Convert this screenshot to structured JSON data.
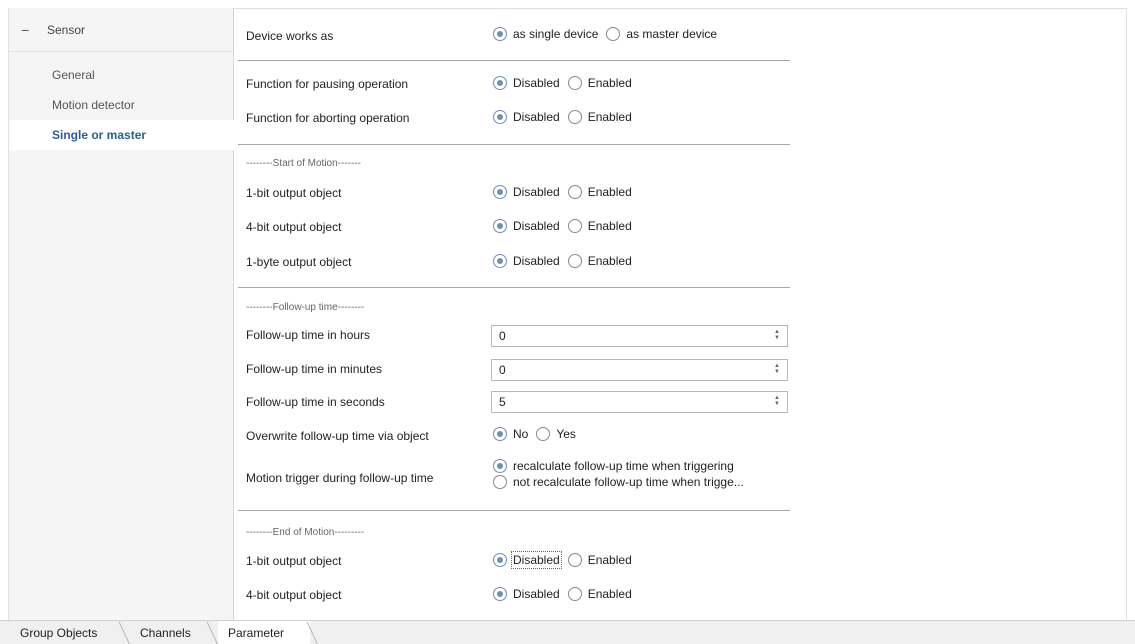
{
  "sidebar": {
    "root_label": "Sensor",
    "items": [
      {
        "label": "General"
      },
      {
        "label": "Motion detector"
      },
      {
        "label": "Single or master"
      }
    ]
  },
  "params": {
    "device_works_as": {
      "label": "Device works as",
      "opt1": "as single device",
      "opt2": "as master device"
    },
    "pausing": {
      "label": "Function for pausing operation",
      "opt1": "Disabled",
      "opt2": "Enabled"
    },
    "aborting": {
      "label": "Function for aborting operation",
      "opt1": "Disabled",
      "opt2": "Enabled"
    },
    "start_header": "--------Start of Motion-------",
    "start_1bit": {
      "label": "1-bit output object",
      "opt1": "Disabled",
      "opt2": "Enabled"
    },
    "start_4bit": {
      "label": "4-bit output object",
      "opt1": "Disabled",
      "opt2": "Enabled"
    },
    "start_1byte": {
      "label": "1-byte output object",
      "opt1": "Disabled",
      "opt2": "Enabled"
    },
    "follow_header": "--------Follow-up time--------",
    "hours": {
      "label": "Follow-up time in hours",
      "value": "0"
    },
    "minutes": {
      "label": "Follow-up time in minutes",
      "value": "0"
    },
    "seconds": {
      "label": "Follow-up time in seconds",
      "value": "5"
    },
    "overwrite": {
      "label": "Overwrite follow-up time via object",
      "opt1": "No",
      "opt2": "Yes"
    },
    "trigger": {
      "label": "Motion trigger during follow-up time",
      "opt1": "recalculate follow-up time when triggering",
      "opt2": "not recalculate follow-up time when trigge..."
    },
    "end_header": "--------End of Motion---------",
    "end_1bit": {
      "label": "1-bit output object",
      "opt1": "Disabled",
      "opt2": "Enabled"
    },
    "end_4bit": {
      "label": "4-bit output object",
      "opt1": "Disabled",
      "opt2": "Enabled"
    }
  },
  "tabs": [
    {
      "label": "Group Objects"
    },
    {
      "label": "Channels"
    },
    {
      "label": "Parameter"
    }
  ]
}
